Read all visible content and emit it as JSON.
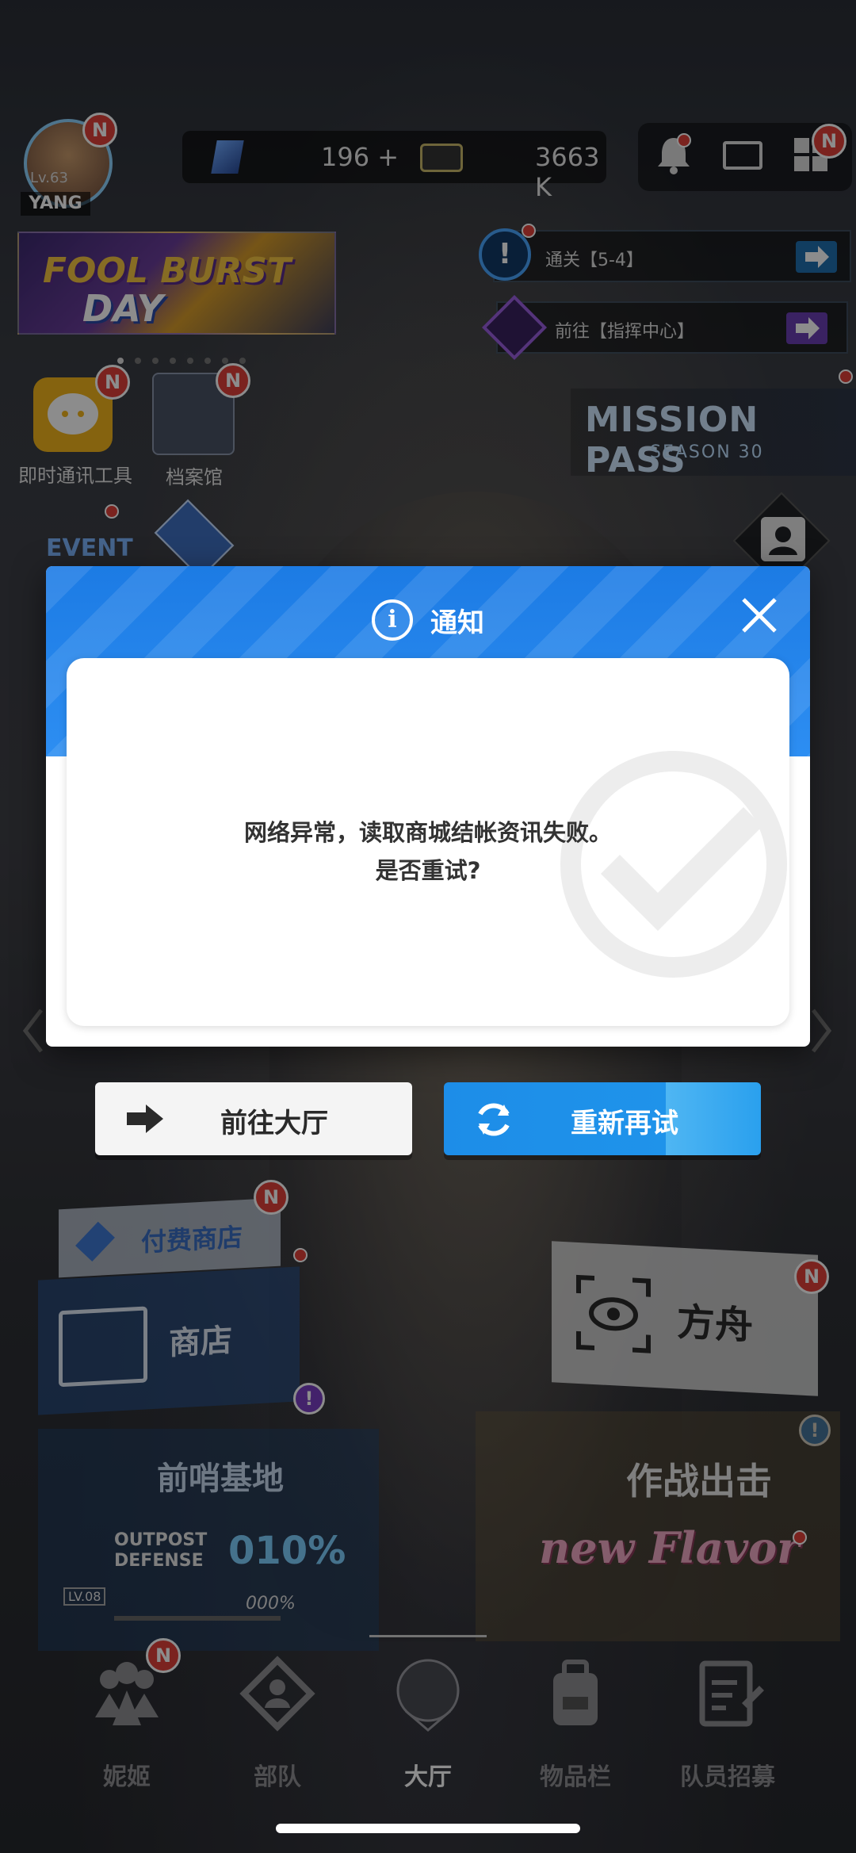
{
  "header": {
    "player_level": "Lv.63",
    "player_name": "YANG",
    "gems": "196 +",
    "credits": "3663 K",
    "badge_n": "N"
  },
  "banners": {
    "event_title": "FOOL BURST",
    "event_subtitle": "DAY",
    "mission_1": "通关【5-4】",
    "mission_2": "前往【指挥中心】",
    "mission_pass_title": "MISSION PASS",
    "mission_pass_season": "SEASON 30"
  },
  "shortcuts": {
    "chat_label": "即时通讯工具",
    "archive_label": "档案馆",
    "event_label": "EVENT"
  },
  "dialog": {
    "title": "通知",
    "message_line1": "网络异常，读取商城结帐资讯失败。",
    "message_line2": "是否重试?"
  },
  "buttons": {
    "go_lobby": "前往大厅",
    "retry": "重新再试"
  },
  "menu": {
    "paid_shop": "付费商店",
    "shop": "商店",
    "ark": "方舟",
    "outpost": "前哨基地",
    "outpost_defense": "OUTPOST DEFENSE",
    "outpost_pct": "010%",
    "outpost_lv": "LV.08",
    "outpost_small_pct": "000%",
    "battle": "作战出击",
    "battle_flavor": "new Flavor"
  },
  "nav": {
    "items": [
      {
        "label": "妮姬"
      },
      {
        "label": "部队"
      },
      {
        "label": "大厅"
      },
      {
        "label": "物品栏"
      },
      {
        "label": "队员招募"
      }
    ]
  },
  "colors": {
    "dialog_blue": "#1c7be4",
    "retry_blue": "#1d8de8",
    "badge_red": "#e0403a"
  }
}
